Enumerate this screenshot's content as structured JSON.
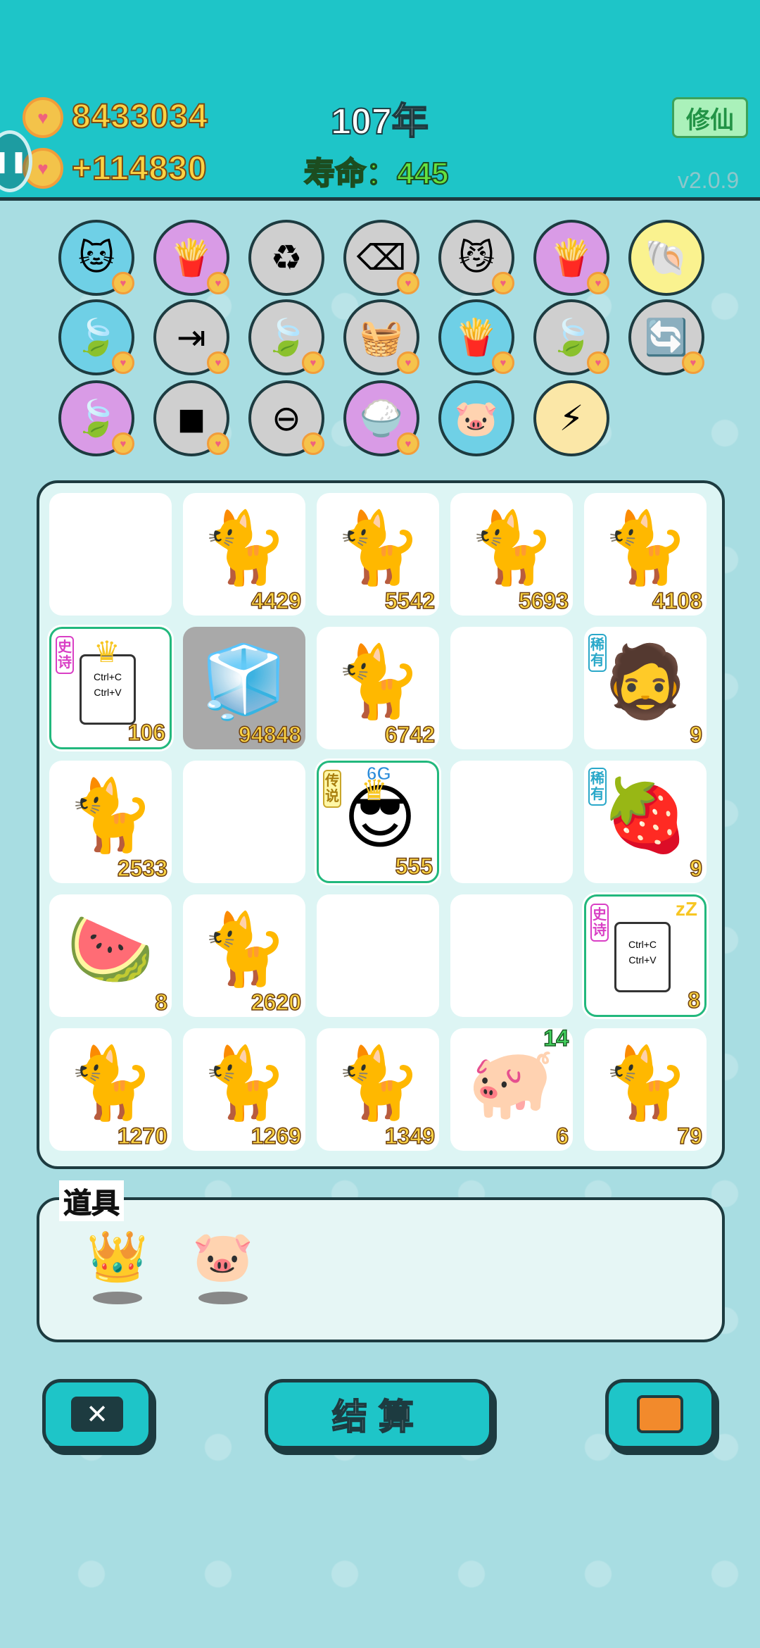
{
  "header": {
    "gold": "8433034",
    "gold_rate": "+114830",
    "year": "107年",
    "lifespan": "寿命：445",
    "cultivate_button": "修仙",
    "version": "v2.0.9"
  },
  "skills": [
    {
      "name": "cat-eat",
      "bg": "#6fd0e6",
      "icon": "🐱",
      "coin": true
    },
    {
      "name": "fries",
      "bg": "#d99be6",
      "icon": "🍟",
      "coin": true
    },
    {
      "name": "recycle",
      "bg": "#cfcfcf",
      "icon": "♻",
      "coin": false
    },
    {
      "name": "delete",
      "bg": "#cfcfcf",
      "icon": "⌫",
      "coin": true
    },
    {
      "name": "cat-faces",
      "bg": "#cfcfcf",
      "icon": "😼",
      "coin": true
    },
    {
      "name": "fries",
      "bg": "#d99be6",
      "icon": "🍟",
      "coin": true
    },
    {
      "name": "shell",
      "bg": "#faf28f",
      "icon": "🐚",
      "coin": false
    },
    {
      "name": "leaf",
      "bg": "#6fd0e6",
      "icon": "🍃",
      "coin": true
    },
    {
      "name": "skip",
      "bg": "#cfcfcf",
      "icon": "⇥",
      "coin": true
    },
    {
      "name": "leaf",
      "bg": "#cfcfcf",
      "icon": "🍃",
      "coin": true
    },
    {
      "name": "basket",
      "bg": "#cfcfcf",
      "icon": "🧺",
      "coin": true
    },
    {
      "name": "fries",
      "bg": "#6fd0e6",
      "icon": "🍟",
      "coin": true
    },
    {
      "name": "leaf",
      "bg": "#cfcfcf",
      "icon": "🍃",
      "coin": true
    },
    {
      "name": "refresh",
      "bg": "#cfcfcf",
      "icon": "🔄",
      "coin": true
    },
    {
      "name": "leaf",
      "bg": "#d99be6",
      "icon": "🍃",
      "coin": true
    },
    {
      "name": "stones",
      "bg": "#cfcfcf",
      "icon": "◼",
      "coin": true
    },
    {
      "name": "minus",
      "bg": "#cfcfcf",
      "icon": "⊖",
      "coin": true
    },
    {
      "name": "rice",
      "bg": "#d99be6",
      "icon": "🍚",
      "coin": true
    },
    {
      "name": "piggy",
      "bg": "#6fd0e6",
      "icon": "🐷",
      "coin": false
    },
    {
      "name": "lightning",
      "bg": "#fbe7a7",
      "icon": "⚡",
      "coin": false
    }
  ],
  "board": [
    [
      {
        "icon": "",
        "num": ""
      },
      {
        "icon": "🐈",
        "num": "4429"
      },
      {
        "icon": "🐈",
        "num": "5542"
      },
      {
        "icon": "🐈",
        "num": "5693"
      },
      {
        "icon": "🐈",
        "num": "4108"
      }
    ],
    [
      {
        "icon": "copy",
        "num": "106",
        "tag": "epic",
        "tag_text": "史诗",
        "framed": true,
        "crown": true
      },
      {
        "icon": "🧊",
        "num": "94848",
        "gray": true
      },
      {
        "icon": "🐈",
        "num": "6742"
      },
      {
        "icon": "",
        "num": ""
      },
      {
        "icon": "🧔",
        "num": "9",
        "tag": "rare",
        "tag_text": "稀有"
      }
    ],
    [
      {
        "icon": "🐈",
        "num": "2533"
      },
      {
        "icon": "",
        "num": ""
      },
      {
        "icon": "😎",
        "num": "555",
        "tag": "legend",
        "tag_text": "传说",
        "framed": true,
        "crown": true,
        "sixg": "6G"
      },
      {
        "icon": "",
        "num": ""
      },
      {
        "icon": "🍓",
        "num": "9",
        "tag": "rare",
        "tag_text": "稀有"
      }
    ],
    [
      {
        "icon": "🍉",
        "num": "8"
      },
      {
        "icon": "🐈",
        "num": "2620"
      },
      {
        "icon": "",
        "num": ""
      },
      {
        "icon": "",
        "num": ""
      },
      {
        "icon": "copy",
        "num": "8",
        "tag": "epic",
        "tag_text": "史诗",
        "framed": true,
        "zzz": true
      }
    ],
    [
      {
        "icon": "🐈",
        "num": "1270"
      },
      {
        "icon": "🐈",
        "num": "1269"
      },
      {
        "icon": "🐈",
        "num": "1349"
      },
      {
        "icon": "🐖",
        "num": "6",
        "badge": "14"
      },
      {
        "icon": "🐈",
        "num": "79"
      }
    ]
  ],
  "copy_card": {
    "line1": "Ctrl+C",
    "line2": "Ctrl+V"
  },
  "items_panel": {
    "title": "道具",
    "items": [
      {
        "name": "crown",
        "icon": "👑"
      },
      {
        "name": "piggy-bank",
        "icon": "🐷"
      }
    ]
  },
  "buttons": {
    "settle": "结算"
  },
  "colors": {
    "header": "#1ec5c8",
    "outline": "#1d3b40",
    "gold_text": "#fbd343",
    "life_text": "#64e23f"
  }
}
